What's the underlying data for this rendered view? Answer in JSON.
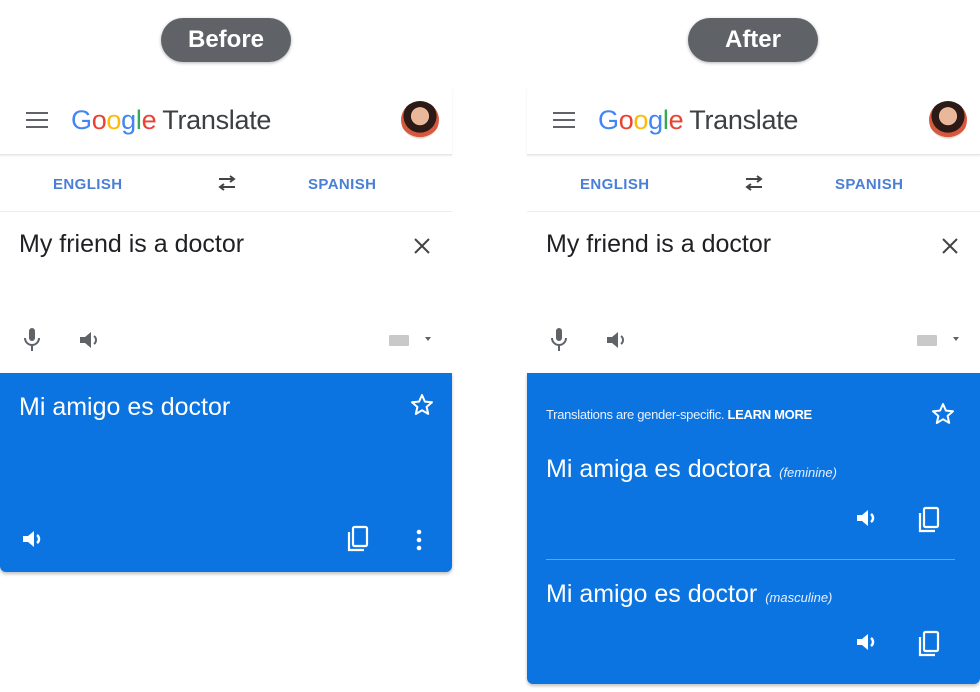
{
  "labels": {
    "before": "Before",
    "after": "After"
  },
  "colors": {
    "pill_bg": "#5f6368",
    "result_bg": "#0b74e0",
    "lang_blue": "#4a7fd6"
  },
  "app": {
    "logo_letters": [
      "G",
      "o",
      "o",
      "g",
      "l",
      "e"
    ],
    "product": "Translate",
    "menu_icon": "hamburger-menu-icon",
    "avatar": "user-avatar"
  },
  "before": {
    "source_lang": "ENGLISH",
    "target_lang": "SPANISH",
    "input_text": "My friend is a doctor",
    "translation": "Mi amigo es doctor",
    "icons": [
      "close-icon",
      "mic-icon",
      "speaker-icon",
      "keyboard-icon",
      "star-icon",
      "copy-icon",
      "more-vert-icon"
    ]
  },
  "after": {
    "source_lang": "ENGLISH",
    "target_lang": "SPANISH",
    "input_text": "My friend is a doctor",
    "notice": "Translations are gender-specific.",
    "learn_more": "LEARN MORE",
    "variants": [
      {
        "text": "Mi amiga es doctora",
        "gender": "(feminine)"
      },
      {
        "text": "Mi amigo es doctor",
        "gender": "(masculine)"
      }
    ],
    "icons": [
      "close-icon",
      "mic-icon",
      "speaker-icon",
      "keyboard-icon",
      "star-icon",
      "copy-icon"
    ]
  }
}
